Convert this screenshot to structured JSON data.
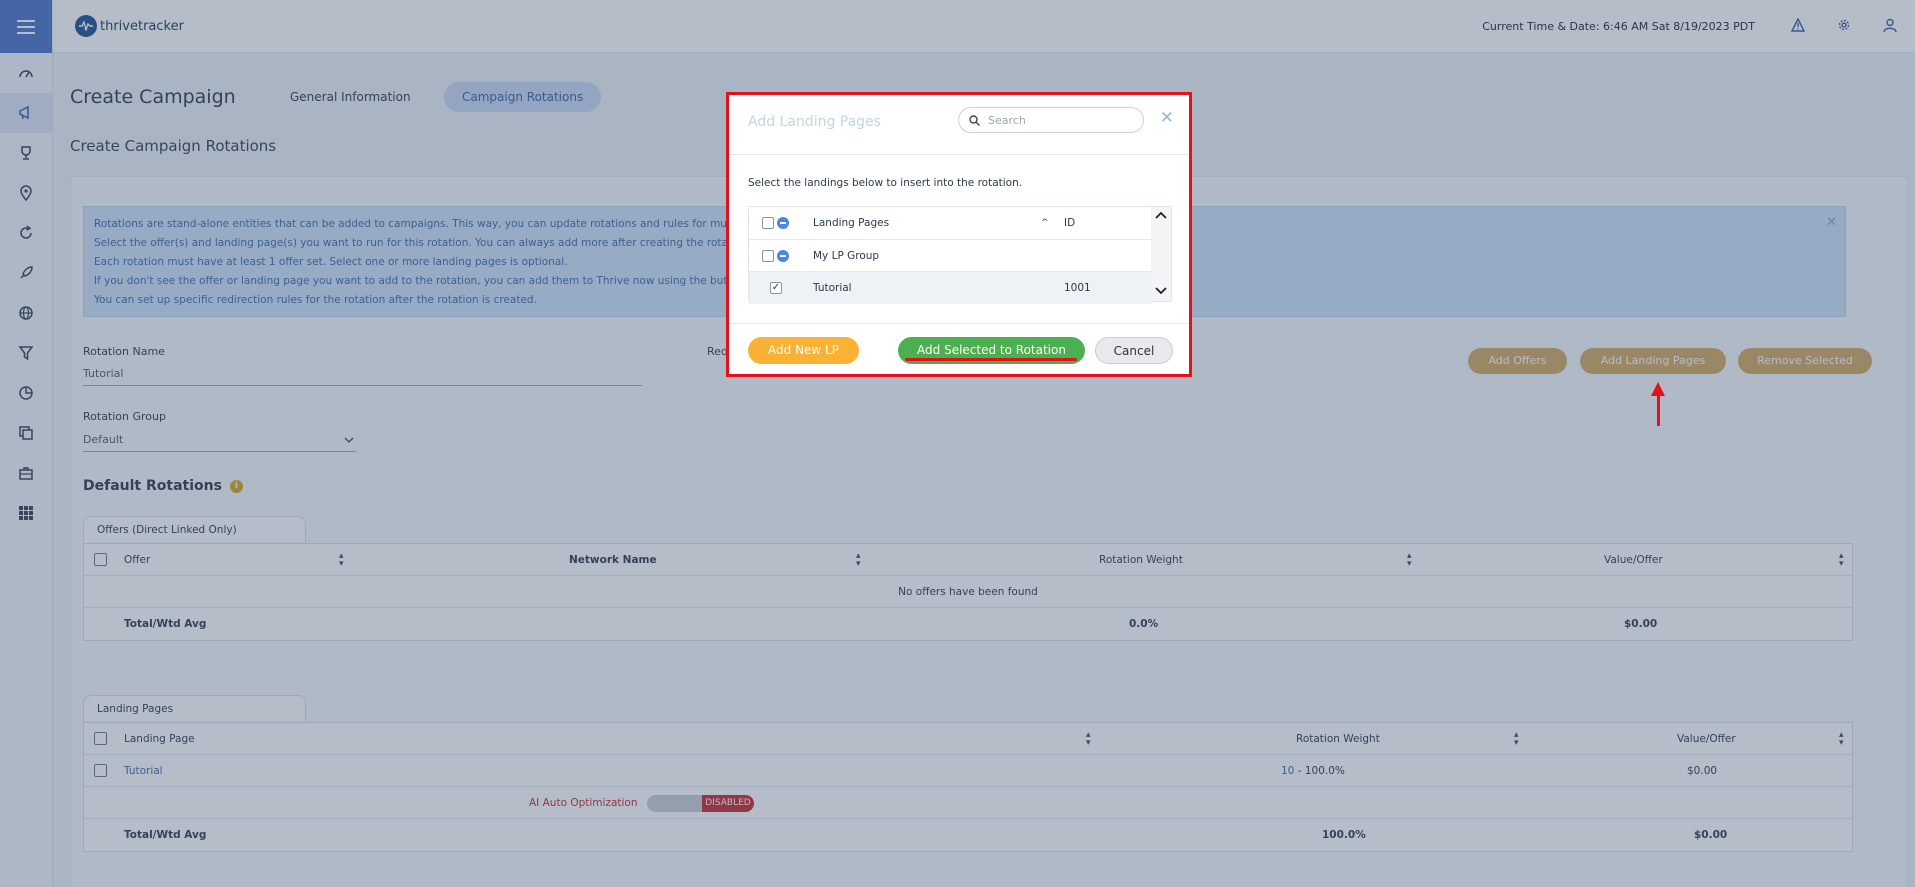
{
  "header": {
    "logo_text": "thrivetracker",
    "clock": "Current Time & Date: 6:46 AM Sat 8/19/2023 PDT"
  },
  "page": {
    "title": "Create Campaign",
    "tabs": [
      "General Information",
      "Campaign Rotations"
    ],
    "subtitle": "Create Campaign Rotations"
  },
  "info_lines": [
    "Rotations are stand-alone entities that can be added to campaigns. This way, you can update rotations and rules for multiple ca",
    "Select the offer(s) and landing page(s) you want to run for this rotation. You can always add more after creating the rotation.",
    "Each rotation must have at least 1 offer set. Select one or more landing pages is optional.",
    "If you don't see the offer or landing page you want to add to the rotation, you can add them to Thrive now using the buttons be",
    "You can set up specific redirection rules for the rotation after the rotation is created."
  ],
  "form": {
    "rotation_name_label": "Rotation Name",
    "rotation_name_value": "Tutorial",
    "redirect_label_partial": "Red",
    "rotation_group_label": "Rotation Group",
    "rotation_group_value": "Default"
  },
  "actions": {
    "add_offers": "Add Offers",
    "add_landing_pages": "Add Landing Pages",
    "remove_selected": "Remove Selected"
  },
  "default_rotations": {
    "title": "Default Rotations",
    "info_icon_glyph": "i",
    "offers_tab": "Offers (Direct Linked Only)",
    "offers_headers": [
      "Offer",
      "Network Name",
      "Rotation Weight",
      "Value/Offer"
    ],
    "offers_empty": "No offers have been found",
    "offers_total": {
      "label": "Total/Wtd Avg",
      "weight": "0.0%",
      "value": "$0.00"
    },
    "lp_tab": "Landing Pages",
    "lp_headers": [
      "Landing Page",
      "Rotation Weight",
      "Value/Offer"
    ],
    "lp_rows": [
      {
        "name": "Tutorial",
        "weight_link": "10",
        "weight_rest": " - 100.0%",
        "value": "$0.00"
      }
    ],
    "ai_label": "AI Auto Optimization",
    "ai_status": "DISABLED",
    "lp_total": {
      "label": "Total/Wtd Avg",
      "weight": "100.0%",
      "value": "$0.00"
    }
  },
  "modal": {
    "title": "Add Landing Pages",
    "search_placeholder": "Search",
    "instruction": "Select the landings below to insert into the rotation.",
    "headers": {
      "name": "Landing Pages",
      "id": "ID"
    },
    "group_name": "My LP Group",
    "rows": [
      {
        "name": "Tutorial",
        "id": "1001",
        "checked": true
      }
    ],
    "check_glyph": "✓",
    "buttons": {
      "add_new": "Add New LP",
      "add_selected": "Add Selected to Rotation",
      "cancel": "Cancel"
    }
  },
  "colors": {
    "accent": "#4a73c8",
    "gold": "#d4a960",
    "green": "#4caf50",
    "orange": "#f9b233",
    "annotation_red": "#e3121a",
    "disabled_red": "#c9262c"
  }
}
